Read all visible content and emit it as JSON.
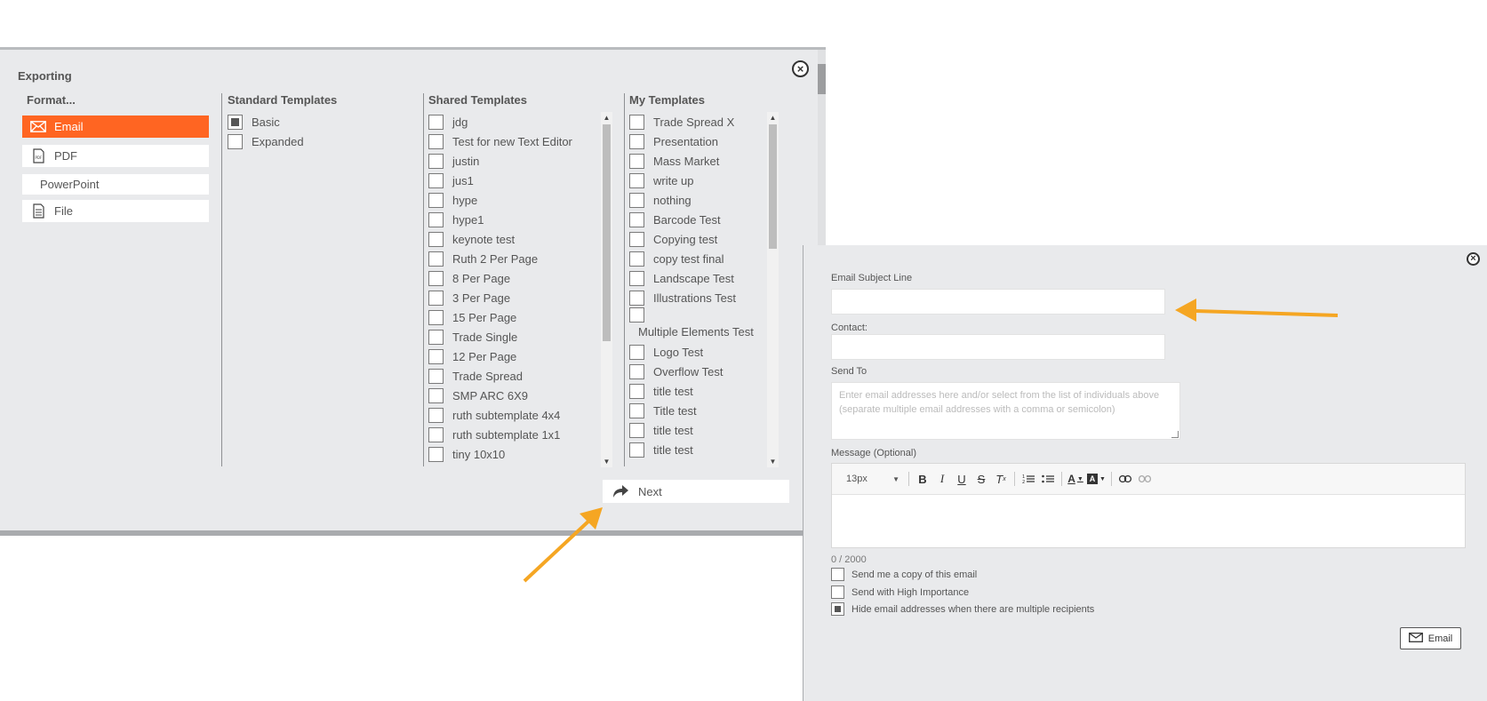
{
  "export": {
    "title": "Exporting",
    "headers": {
      "format": "Format...",
      "standard": "Standard Templates",
      "shared": "Shared Templates",
      "mine": "My Templates"
    },
    "formats": [
      {
        "label": "Email",
        "icon": "envelope-icon",
        "active": true
      },
      {
        "label": "PDF",
        "icon": "pdf-file-icon",
        "active": false
      },
      {
        "label": "PowerPoint",
        "icon": "",
        "active": false
      },
      {
        "label": "File",
        "icon": "document-icon",
        "active": false
      }
    ],
    "standard_templates": [
      {
        "label": "Basic",
        "checked": true
      },
      {
        "label": "Expanded",
        "checked": false
      }
    ],
    "shared_templates": [
      "jdg",
      "Test for new Text Editor",
      "justin",
      "jus1",
      "hype",
      "hype1",
      "keynote test",
      "Ruth 2 Per Page",
      "8 Per Page",
      "3 Per Page",
      "15 Per Page",
      "Trade Single",
      "12 Per Page",
      "Trade Spread",
      "SMP ARC 6X9",
      "ruth subtemplate 4x4",
      "ruth subtemplate 1x1",
      "tiny 10x10"
    ],
    "my_templates": [
      "Trade Spread X",
      "Presentation",
      "Mass Market",
      "write up",
      "nothing",
      "Barcode Test",
      "Copying test",
      "copy test final",
      "Landscape Test",
      "Illustrations Test",
      "Multiple Elements Test",
      "Logo Test",
      "Overflow Test",
      "title test",
      "Title test",
      "title test",
      "title test"
    ],
    "next_label": "Next"
  },
  "email": {
    "subject_label": "Email Subject Line",
    "subject_value": "",
    "contact_label": "Contact:",
    "contact_value": "",
    "send_to_label": "Send To",
    "send_to_placeholder": "Enter email addresses here and/or select from the list of individuals above (separate multiple email addresses with a comma or semicolon)",
    "message_label": "Message (Optional)",
    "font_size": "13px",
    "char_count": "0 / 2000",
    "options": [
      {
        "label": "Send me a copy of this email",
        "checked": false
      },
      {
        "label": "Send with High Importance",
        "checked": false
      },
      {
        "label": "Hide email addresses when there are multiple recipients",
        "checked": true
      }
    ],
    "send_label": "Email"
  },
  "colors": {
    "accent": "#ff6522",
    "panel_bg": "#e9eaec",
    "annotation_arrow": "#f5a623"
  }
}
